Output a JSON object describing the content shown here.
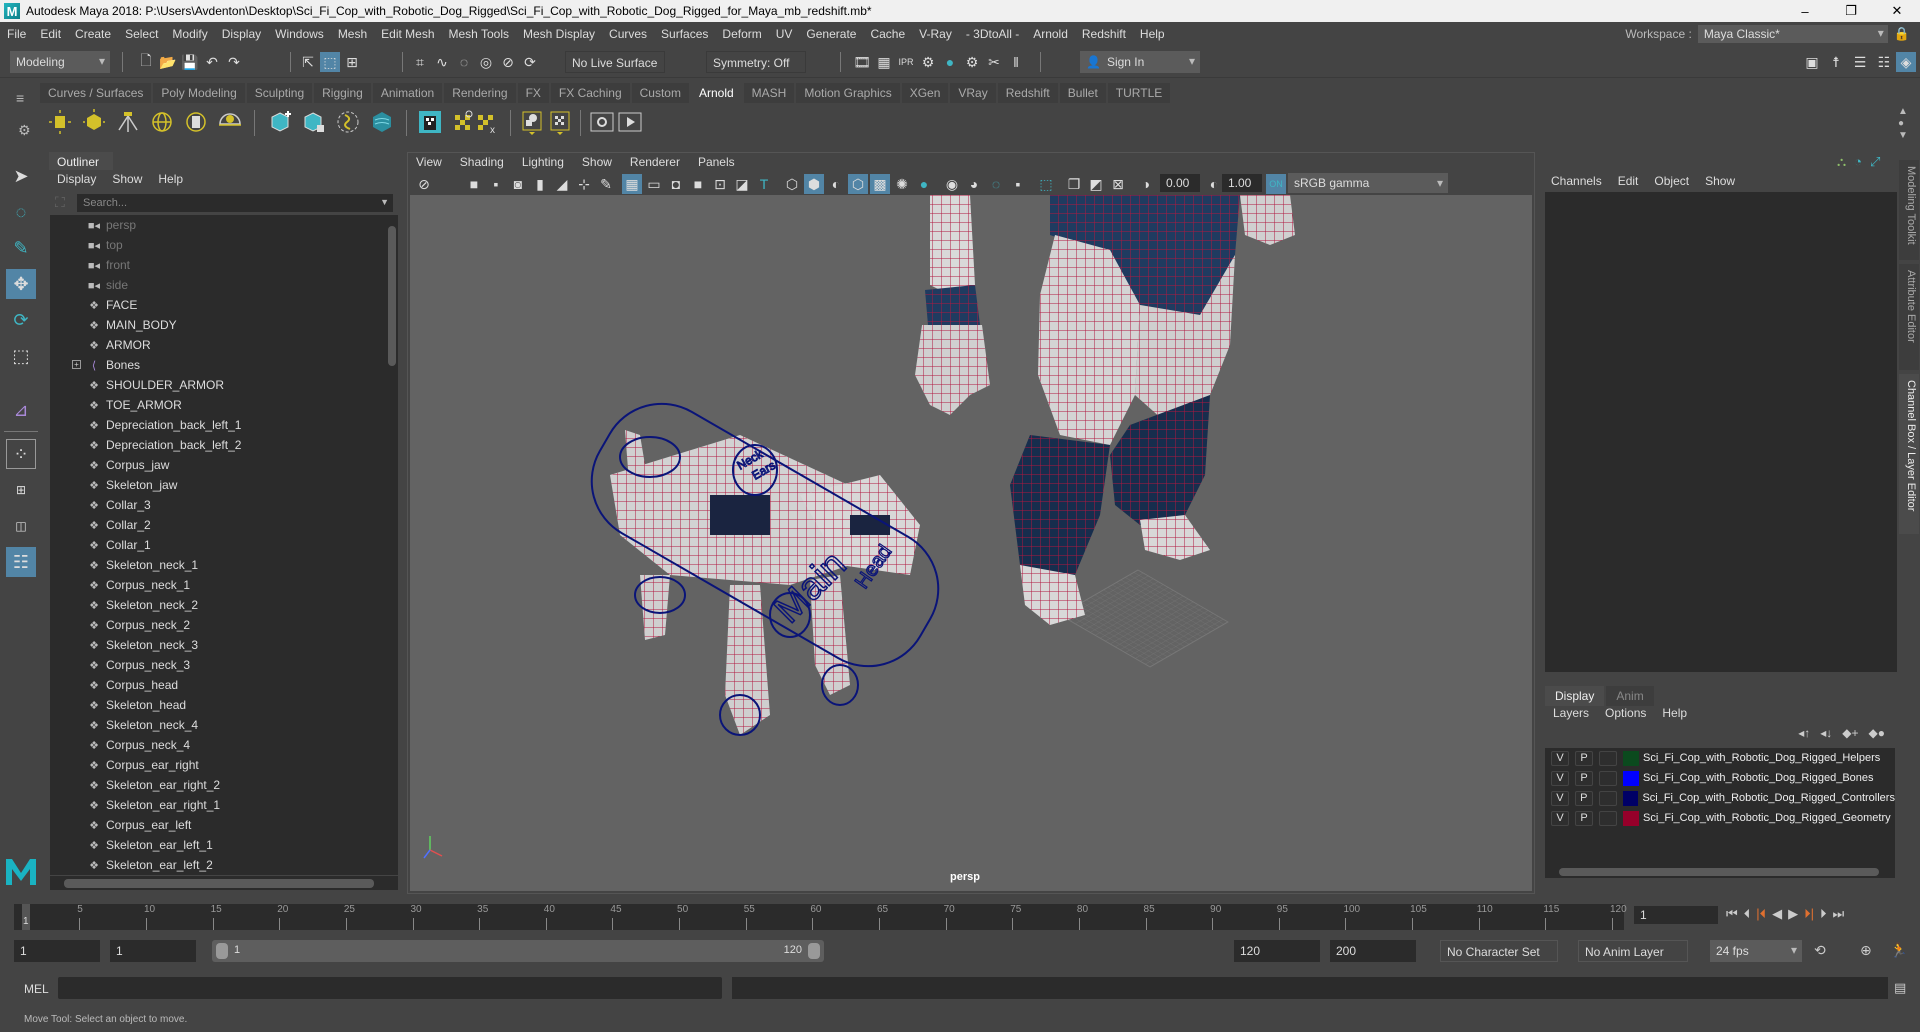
{
  "window": {
    "title": "Autodesk Maya 2018: P:\\Users\\Avdenton\\Desktop\\Sci_Fi_Cop_with_Robotic_Dog_Rigged\\Sci_Fi_Cop_with_Robotic_Dog_Rigged_for_Maya_mb_redshift.mb*",
    "minimize": "–",
    "maximize": "❐",
    "close": "✕"
  },
  "menubar": {
    "items": [
      "File",
      "Edit",
      "Create",
      "Select",
      "Modify",
      "Display",
      "Windows",
      "Mesh",
      "Edit Mesh",
      "Mesh Tools",
      "Mesh Display",
      "Curves",
      "Surfaces",
      "Deform",
      "UV",
      "Generate",
      "Cache",
      "V-Ray",
      "- 3DtoAll -",
      "Arnold",
      "Redshift",
      "Help"
    ],
    "workspace_label": "Workspace :",
    "workspace_value": "Maya Classic*"
  },
  "statusline": {
    "mode": "Modeling",
    "live_surface": "No Live Surface",
    "symmetry": "Symmetry: Off",
    "sign_in": "Sign In"
  },
  "shelf": {
    "tabs": [
      "Curves / Surfaces",
      "Poly Modeling",
      "Sculpting",
      "Rigging",
      "Animation",
      "Rendering",
      "FX",
      "FX Caching",
      "Custom",
      "Arnold",
      "MASH",
      "Motion Graphics",
      "XGen",
      "VRay",
      "Redshift",
      "Bullet",
      "TURTLE"
    ],
    "active_tab": "Arnold"
  },
  "outliner": {
    "title": "Outliner",
    "menu": [
      "Display",
      "Show",
      "Help"
    ],
    "search_placeholder": "Search...",
    "items": [
      {
        "name": "persp",
        "type": "camera"
      },
      {
        "name": "top",
        "type": "camera"
      },
      {
        "name": "front",
        "type": "camera"
      },
      {
        "name": "side",
        "type": "camera"
      },
      {
        "name": "FACE",
        "type": "group"
      },
      {
        "name": "MAIN_BODY",
        "type": "group"
      },
      {
        "name": "ARMOR",
        "type": "group"
      },
      {
        "name": "Bones",
        "type": "joint",
        "expandable": true
      },
      {
        "name": "SHOULDER_ARMOR",
        "type": "group"
      },
      {
        "name": "TOE_ARMOR",
        "type": "group"
      },
      {
        "name": "Depreciation_back_left_1",
        "type": "group"
      },
      {
        "name": "Depreciation_back_left_2",
        "type": "group"
      },
      {
        "name": "Corpus_jaw",
        "type": "group"
      },
      {
        "name": "Skeleton_jaw",
        "type": "group"
      },
      {
        "name": "Collar_3",
        "type": "group"
      },
      {
        "name": "Collar_2",
        "type": "group"
      },
      {
        "name": "Collar_1",
        "type": "group"
      },
      {
        "name": "Skeleton_neck_1",
        "type": "group"
      },
      {
        "name": "Corpus_neck_1",
        "type": "group"
      },
      {
        "name": "Skeleton_neck_2",
        "type": "group"
      },
      {
        "name": "Corpus_neck_2",
        "type": "group"
      },
      {
        "name": "Skeleton_neck_3",
        "type": "group"
      },
      {
        "name": "Corpus_neck_3",
        "type": "group"
      },
      {
        "name": "Corpus_head",
        "type": "group"
      },
      {
        "name": "Skeleton_head",
        "type": "group"
      },
      {
        "name": "Skeleton_neck_4",
        "type": "group"
      },
      {
        "name": "Corpus_neck_4",
        "type": "group"
      },
      {
        "name": "Corpus_ear_right",
        "type": "group"
      },
      {
        "name": "Skeleton_ear_right_2",
        "type": "group"
      },
      {
        "name": "Skeleton_ear_right_1",
        "type": "group"
      },
      {
        "name": "Corpus_ear_left",
        "type": "group"
      },
      {
        "name": "Skeleton_ear_left_1",
        "type": "group"
      },
      {
        "name": "Skeleton_ear_left_2",
        "type": "group"
      }
    ]
  },
  "viewport": {
    "menu": [
      "View",
      "Shading",
      "Lighting",
      "Show",
      "Renderer",
      "Panels"
    ],
    "exposure": "0.00",
    "gamma": "1.00",
    "color_space": "sRGB gamma",
    "camera_label": "persp",
    "scene_labels": {
      "main": "Main",
      "head": "Head",
      "neck": "Neck",
      "ears": "Ears"
    }
  },
  "channelbox": {
    "menu": [
      "Channels",
      "Edit",
      "Object",
      "Show"
    ]
  },
  "layereditor": {
    "tabs": [
      "Display",
      "Anim"
    ],
    "active_tab": "Display",
    "menu": [
      "Layers",
      "Options",
      "Help"
    ],
    "layers": [
      {
        "v": "V",
        "p": "P",
        "color": "#0b4a1e",
        "name": "Sci_Fi_Cop_with_Robotic_Dog_Rigged_Helpers"
      },
      {
        "v": "V",
        "p": "P",
        "color": "#0000ff",
        "name": "Sci_Fi_Cop_with_Robotic_Dog_Rigged_Bones"
      },
      {
        "v": "V",
        "p": "P",
        "color": "#000066",
        "name": "Sci_Fi_Cop_with_Robotic_Dog_Rigged_Controllers"
      },
      {
        "v": "V",
        "p": "P",
        "color": "#96002a",
        "name": "Sci_Fi_Cop_with_Robotic_Dog_Rigged_Geometry"
      }
    ]
  },
  "sidetabs": [
    "Modeling Toolkit",
    "Attribute Editor",
    "Channel Box / Layer Editor"
  ],
  "timeline": {
    "ticks": [
      5,
      10,
      15,
      20,
      25,
      30,
      35,
      40,
      45,
      50,
      55,
      60,
      65,
      70,
      75,
      80,
      85,
      90,
      95,
      100,
      105,
      110,
      115,
      120
    ],
    "current_frame": "1",
    "current_frame_field": "1",
    "range_start": 1,
    "range_end": 120
  },
  "range": {
    "start_time": "1",
    "playback_start": "1",
    "slider_start": "1",
    "slider_end": "120",
    "playback_end": "120",
    "end_time": "200",
    "character_set": "No Character Set",
    "anim_layer": "No Anim Layer",
    "fps": "24 fps"
  },
  "cmdline": {
    "label": "MEL"
  },
  "helpline": {
    "text": "Move Tool: Select an object to move."
  }
}
